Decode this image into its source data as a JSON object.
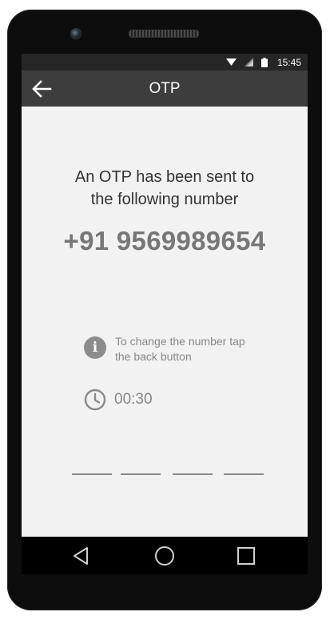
{
  "status_bar": {
    "time": "15:45",
    "icons": [
      "wifi-icon",
      "signal-icon",
      "battery-icon"
    ]
  },
  "app_bar": {
    "title": "OTP",
    "back_icon": "back-arrow-icon"
  },
  "main": {
    "message_line1": "An OTP has been sent to",
    "message_line2": "the following number",
    "phone_number": "+91 9569989654",
    "info_text_line1": "To change the number tap",
    "info_text_line2": "the back button",
    "info_icon": "info-icon",
    "timer_icon": "clock-icon",
    "timer": "00:30",
    "otp_digits": [
      "",
      "",
      "",
      ""
    ]
  },
  "nav_bar": {
    "buttons": [
      "back-triangle-icon",
      "home-circle-icon",
      "recents-square-icon"
    ]
  },
  "colors": {
    "status_bar": "#262626",
    "app_bar": "#3d3d3d",
    "screen_bg": "#f2f2f2",
    "phone_body": "#0d0d0d",
    "number_text": "#777777",
    "muted_text": "#888888"
  }
}
